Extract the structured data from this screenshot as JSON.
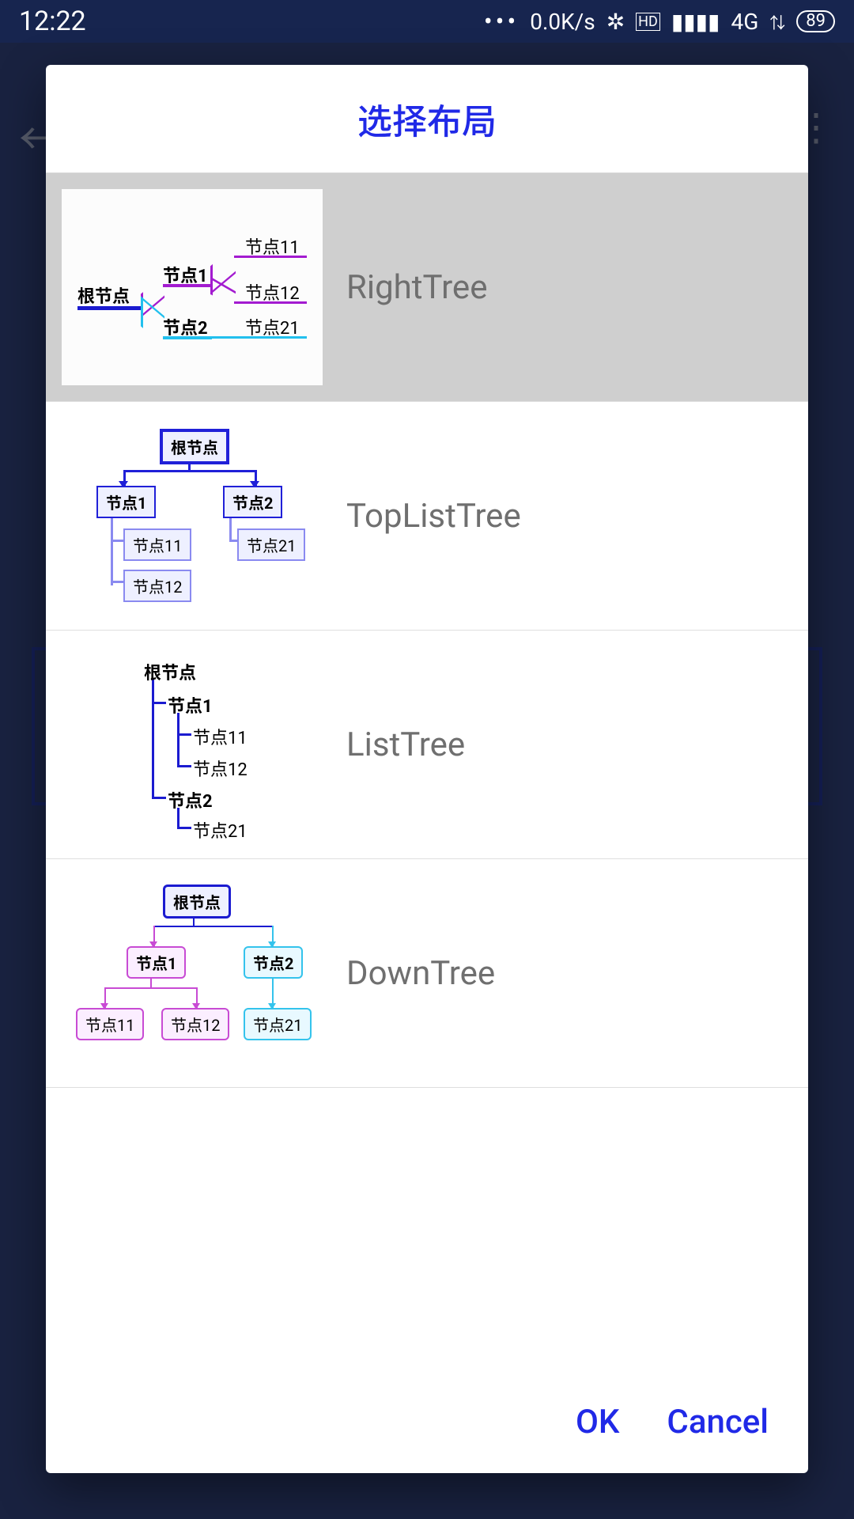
{
  "statusbar": {
    "time": "12:22",
    "speed": "0.0K/s",
    "network": "4G",
    "hd": "HD",
    "battery": "89"
  },
  "dialog": {
    "title": "选择布局",
    "ok": "OK",
    "cancel": "Cancel"
  },
  "options": [
    {
      "label": "RightTree",
      "selected": true
    },
    {
      "label": "TopListTree",
      "selected": false
    },
    {
      "label": "ListTree",
      "selected": false
    },
    {
      "label": "DownTree",
      "selected": false
    }
  ],
  "nodes": {
    "root": "根节点",
    "n1": "节点1",
    "n2": "节点2",
    "n11": "节点11",
    "n12": "节点12",
    "n21": "节点21"
  }
}
